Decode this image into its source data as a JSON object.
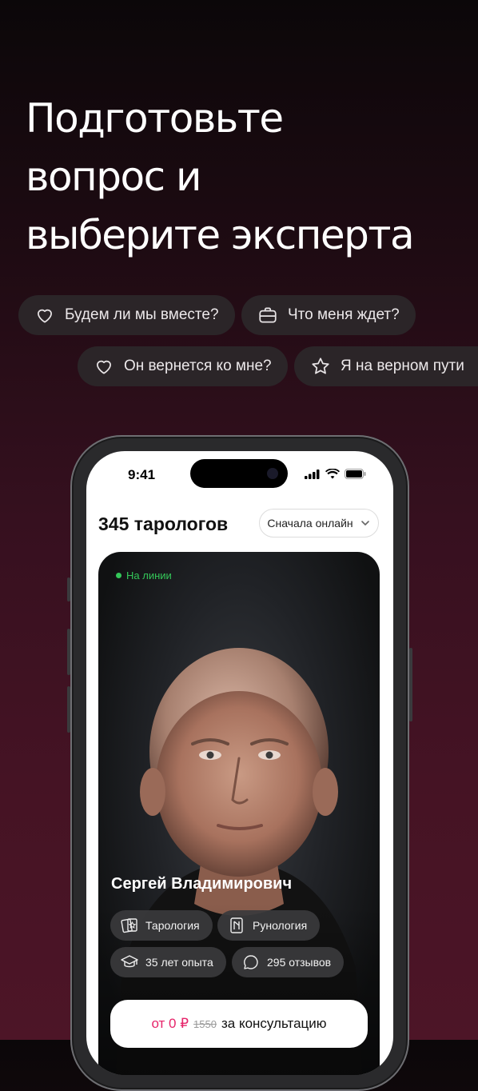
{
  "headline": {
    "line1": "Подготовьте",
    "line2": "вопрос и",
    "line3": "выберите эксперта"
  },
  "chips": [
    {
      "label": "Будем ли мы вместе?",
      "icon": "heart-icon"
    },
    {
      "label": "Что меня ждет?",
      "icon": "briefcase-icon"
    },
    {
      "label": "Он вернется ко мне?",
      "icon": "heart-icon"
    },
    {
      "label": "Я на верном пути",
      "icon": "star-icon"
    }
  ],
  "phone": {
    "status_time": "9:41",
    "count_title": "345 тарологов",
    "sort_label": "Сначала онлайн",
    "card": {
      "status": "На линии",
      "name": "Сергей Владимирович",
      "tags": [
        {
          "label": "Тарология",
          "icon": "tarot-cards-icon"
        },
        {
          "label": "Рунология",
          "icon": "rune-icon"
        },
        {
          "label": "35 лет опыта",
          "icon": "graduation-cap-icon"
        },
        {
          "label": "295 отзывов",
          "icon": "chat-bubble-icon"
        }
      ],
      "price": {
        "prefix": "от 0 ₽",
        "old": "1550",
        "suffix": "за консультацию"
      }
    }
  },
  "colors": {
    "accent_pink": "#e6246a",
    "online_green": "#34c759",
    "chip_bg": "#2b2528"
  }
}
